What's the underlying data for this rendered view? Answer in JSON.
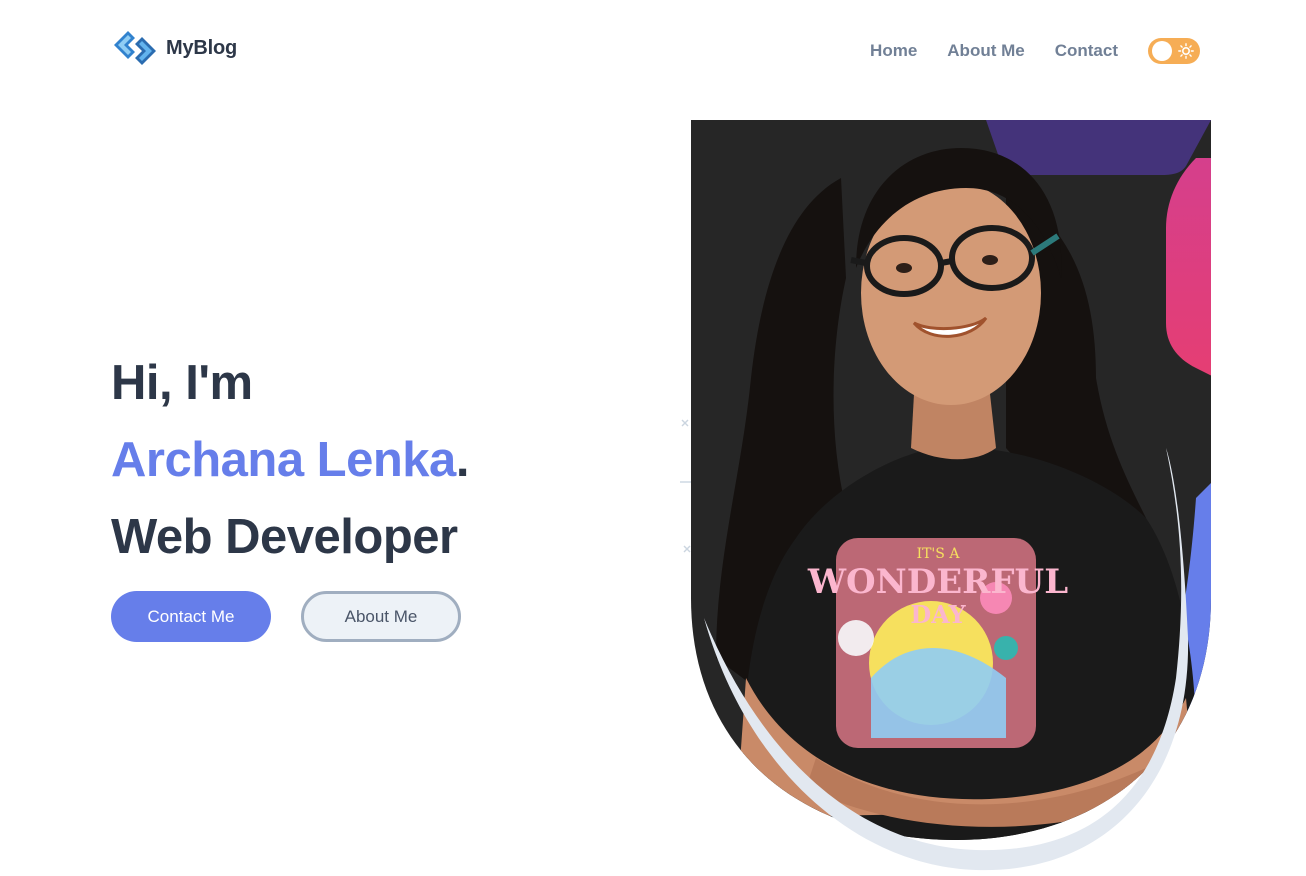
{
  "header": {
    "logo_text": "MyBlog",
    "nav": [
      "Home",
      "About Me",
      "Contact"
    ],
    "theme_toggle": {
      "mode": "light",
      "icon": "sun-icon"
    }
  },
  "hero": {
    "greeting": "Hi, I'm",
    "name": "Archana Lenka",
    "name_suffix": ".",
    "role": "Web Developer",
    "primary_button": "Contact Me",
    "secondary_button": "About Me",
    "photo_alt": "portrait-photo"
  },
  "colors": {
    "accent": "#667eea",
    "heading": "#2d3748",
    "nav": "#718096",
    "toggle": "#f6ad55",
    "photo_backdrop": "#262626"
  }
}
